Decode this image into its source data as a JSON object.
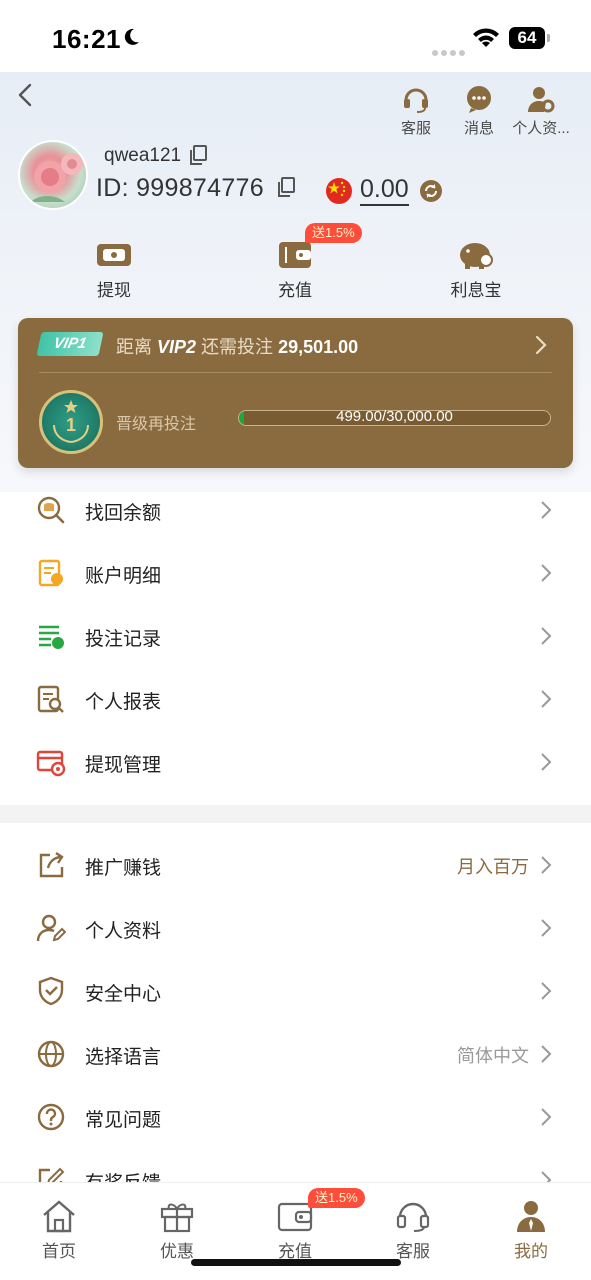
{
  "status_bar": {
    "time": "16:21",
    "battery": "64"
  },
  "header": {
    "top_actions": [
      {
        "label": "客服",
        "icon": "headset-icon"
      },
      {
        "label": "消息",
        "icon": "chat-icon"
      },
      {
        "label": "个人资...",
        "icon": "user-settings-icon"
      }
    ]
  },
  "profile": {
    "username": "qwea121",
    "id_text": "ID: 999874776",
    "balance": "0.00",
    "currency_flag": "china-flag-icon"
  },
  "quick_actions": [
    {
      "label": "提现",
      "icon": "withdraw-icon"
    },
    {
      "label": "充值",
      "icon": "wallet-icon",
      "promo": "送1.5%"
    },
    {
      "label": "利息宝",
      "icon": "piggy-bank-icon"
    }
  ],
  "vip": {
    "badge": "VIP1",
    "prefix": "距离",
    "next_level": "VIP2",
    "middle": "还需投注",
    "amount": "29,501.00",
    "level_number": "1",
    "progress_label": "晋级再投注",
    "progress_text": "499.00/30,000.00",
    "progress_fraction": 0.0166
  },
  "menu_group_1": [
    {
      "label": "找回余额",
      "icon": "recover-balance-icon"
    },
    {
      "label": "账户明细",
      "icon": "account-details-icon"
    },
    {
      "label": "投注记录",
      "icon": "bet-record-icon"
    },
    {
      "label": "个人报表",
      "icon": "report-icon"
    },
    {
      "label": "提现管理",
      "icon": "withdraw-manage-icon"
    }
  ],
  "menu_group_2": [
    {
      "label": "推广赚钱",
      "icon": "share-icon",
      "value": "月入百万"
    },
    {
      "label": "个人资料",
      "icon": "profile-edit-icon",
      "value": ""
    },
    {
      "label": "安全中心",
      "icon": "shield-icon",
      "value": ""
    },
    {
      "label": "选择语言",
      "icon": "globe-icon",
      "value": "简体中文"
    },
    {
      "label": "常见问题",
      "icon": "question-icon",
      "value": ""
    },
    {
      "label": "有奖反馈",
      "icon": "feedback-icon",
      "value": ""
    }
  ],
  "tabs": [
    {
      "label": "首页",
      "icon": "home-icon"
    },
    {
      "label": "优惠",
      "icon": "gift-icon"
    },
    {
      "label": "充值",
      "icon": "wallet-icon",
      "promo": "送1.5%"
    },
    {
      "label": "客服",
      "icon": "headset-icon"
    },
    {
      "label": "我的",
      "icon": "person-icon",
      "active": true
    }
  ],
  "colors": {
    "accent": "#8a6b40",
    "promo": "#ff4d3b",
    "progress": "#1ea83c"
  }
}
